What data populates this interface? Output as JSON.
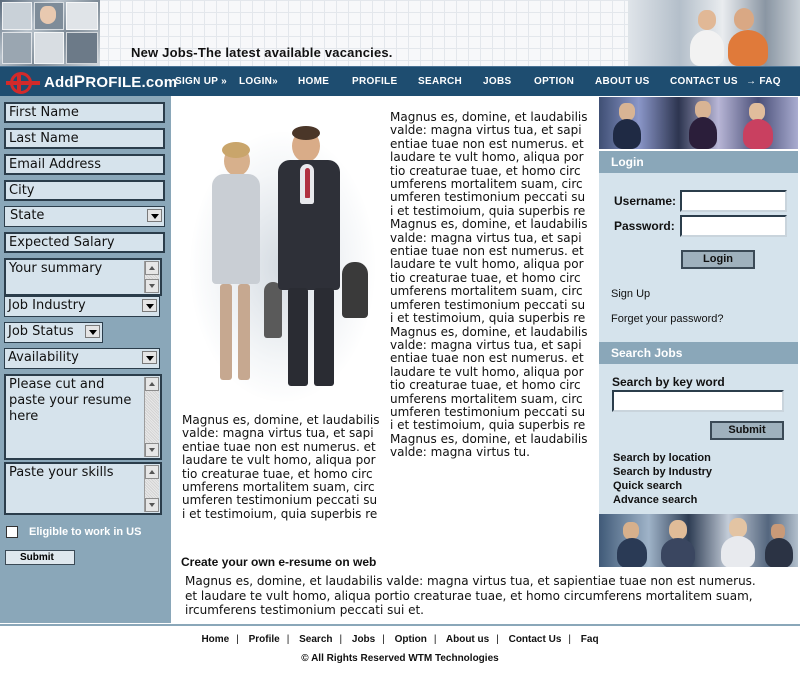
{
  "header": {
    "tagline": "New Jobs-The latest available vacancies."
  },
  "logo": {
    "part1": "Add",
    "part2_big": "P",
    "part2_rest": "ROFILE",
    "part3": ".com"
  },
  "nav": {
    "signup": "SIGN UP »",
    "login": "LOGIN»",
    "home": "HOME",
    "profile": "PROFILE",
    "search": "SEARCH",
    "jobs": "JOBS",
    "option": "OPTION",
    "about": "ABOUT US",
    "contact": "CONTACT US",
    "faq": "→ FAQ"
  },
  "form": {
    "first_name": "First Name",
    "last_name": "Last Name",
    "email": "Email Address",
    "city": "City",
    "state": "State",
    "expected_salary": "Expected Salary",
    "summary": "Your summary",
    "job_industry": "Job Industry",
    "job_status": "Job Status",
    "availability": "Availability",
    "resume": "Please cut and paste your resume here",
    "skills": "Paste your skills",
    "eligible_label": "Eligible to work in US",
    "submit": "Submit"
  },
  "main": {
    "para_right": "Magnus es, domine, et laudabilis valde: magna virtus tua, et sapientiae tuae non est numerus. et laudare te vult homo, aliqua portio creaturae tuae, et homo circumferens mortalitem suam, circumferen testimonium peccati sui et testimoium, quia superbis re Magnus es, domine, et laudabilis valde: magna virtus tua, et sapientiae tuae non est numerus. et laudare te vult homo, aliqua portio creaturae tuae, et homo circumferens mortalitem suam, circumferen testimonium peccati sui et testimoium, quia superbis re Magnus es, domine, et laudabilis valde: magna virtus tua, et sapientiae tuae non est numerus. et laudare te vult homo, aliqua portio creaturae tuae, et homo circumferens mortalitem suam, circumferen testimonium peccati sui et testimoium, quia superbis re Magnus es, domine, et laudabilis valde: magna virtus tu.",
    "para_left": "Magnus es, domine, et laudabilis valde: magna virtus tua, et sapientiae tuae non est numerus. et laudare te vult homo, aliqua portio creaturae tuae, et homo circumferens mortalitem suam, circumferen testimonium peccati sui et testimoium, quia superbis re",
    "create_heading": "Create your own e-resume on web",
    "create_body": "Magnus es, domine, et laudabilis valde: magna virtus tua, et sapientiae tuae non est numerus. et laudare te vult homo, aliqua portio creaturae tuae, et homo circumferens mortalitem suam, ircumferens testimonium peccati sui et."
  },
  "login": {
    "heading": "Login",
    "username_label": "Username:",
    "password_label": "Password:",
    "button": "Login",
    "signup_link": "Sign Up",
    "forgot_link": "Forget your password?"
  },
  "search": {
    "heading": "Search Jobs",
    "keyword_label": "Search by key word",
    "button": "Submit",
    "links": [
      "Search by location",
      "Search by Industry",
      "Quick search",
      "Advance search"
    ]
  },
  "footer": {
    "links": [
      "Home",
      "Profile",
      "Search",
      "Jobs",
      "Option",
      "About us",
      "Contact Us",
      "Faq"
    ],
    "separator": "|",
    "copyright": "© All Rights Reserved WTM Technologies"
  },
  "colors": {
    "navbar": "#1e4d70",
    "sidebar": "#8aa7b9",
    "panel": "#d5e3ec",
    "logo_red": "#d22a2a"
  }
}
